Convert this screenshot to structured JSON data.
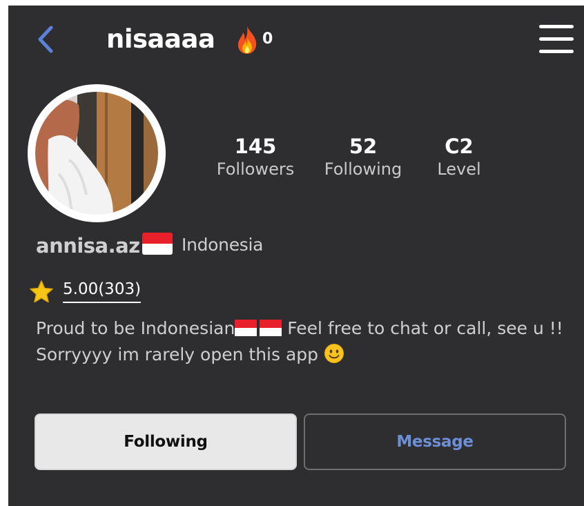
{
  "header": {
    "title": "nisaaaa",
    "streak_count": "0",
    "back_icon": "chevron-left-icon",
    "streak_icon": "fire-icon",
    "menu_icon": "hamburger-menu-icon"
  },
  "stats": [
    {
      "value": "145",
      "label": "Followers"
    },
    {
      "value": "52",
      "label": "Following"
    },
    {
      "value": "C2",
      "label": "Level"
    }
  ],
  "profile": {
    "username": "annisa.az",
    "country": "Indonesia",
    "country_flag_icon": "indonesia-flag-icon",
    "rating": "5.00(303)",
    "rating_icon": "star-icon"
  },
  "bio": {
    "line1_part1": "Proud to be Indonesian",
    "line1_part2": " Feel free to chat or call, see u !!",
    "line2": "Sorryyyy im rarely open this app "
  },
  "actions": {
    "following_label": "Following",
    "message_label": "Message"
  },
  "colors": {
    "background": "#2e2e30",
    "accent_blue": "#6d8fd6",
    "star_yellow": "#f5c518",
    "flag_red": "#e8202b"
  }
}
